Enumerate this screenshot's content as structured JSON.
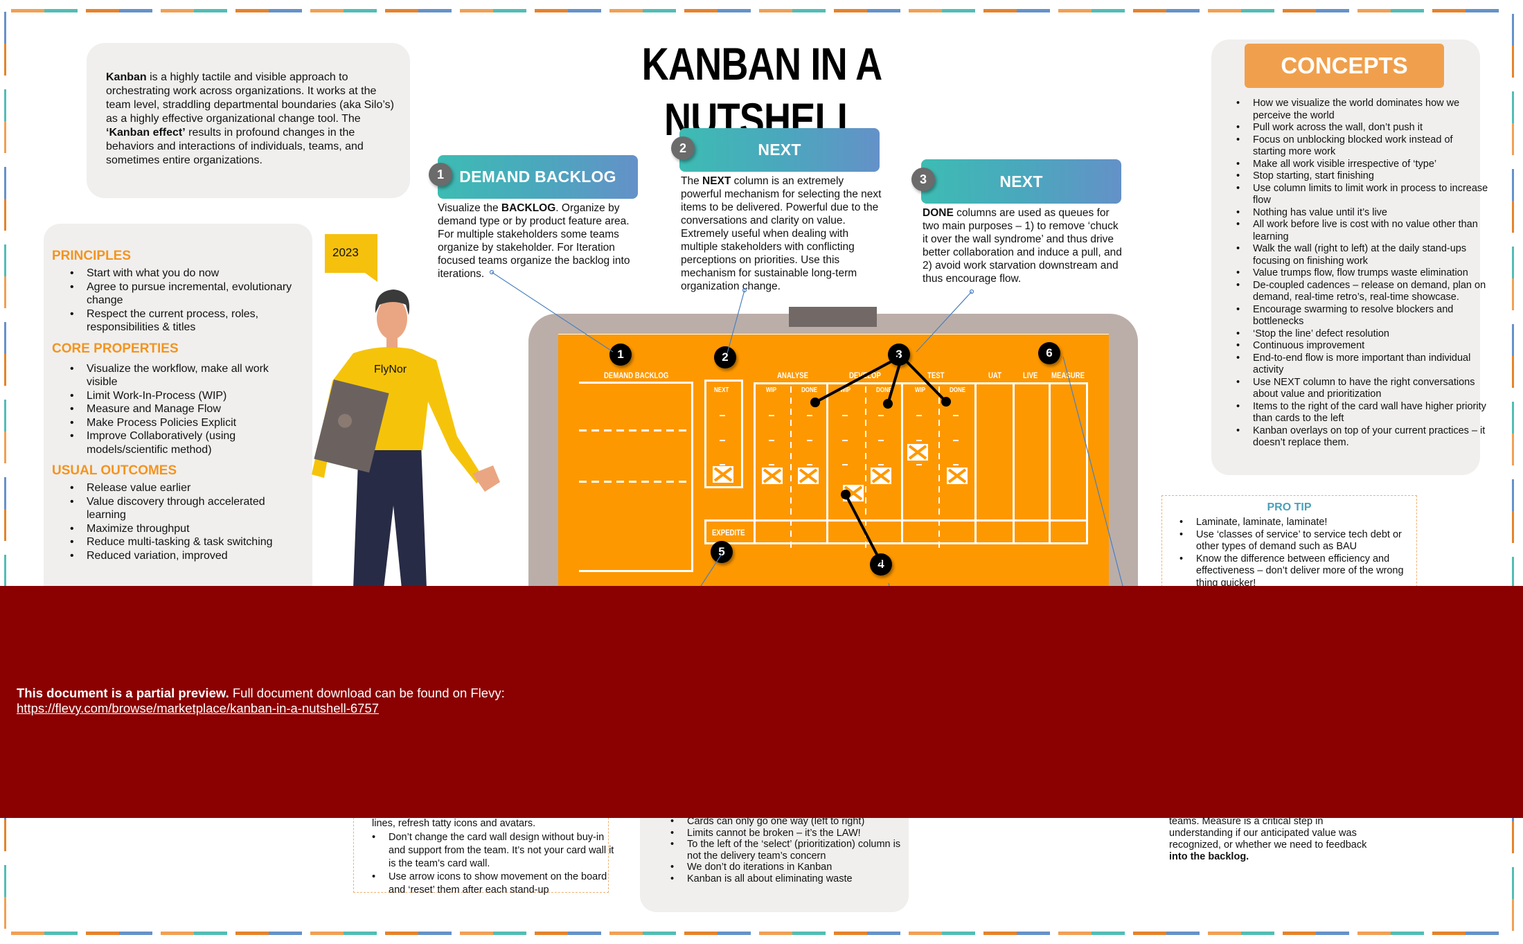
{
  "title": "KANBAN IN A NUTSHELL",
  "intro": {
    "bold_lead": "Kanban",
    "text_1": " is a highly tactile and visible approach to orchestrating work across  organizations. It works at the team level, straddling departmental boundaries (aka Silo’s) as a highly effective organizational change tool. The ",
    "bold_mid": "‘Kanban effect’",
    "text_2": " results in  profound changes in the behaviors and interactions of individuals, teams, and sometimes entire organizations."
  },
  "left_panel": {
    "principles_title": "PRINCIPLES",
    "principles": [
      "Start with what you do now",
      "Agree to pursue incremental, evolutionary change",
      "Respect the current process, roles, responsibilities & titles"
    ],
    "core_title": "CORE PROPERTIES",
    "core": [
      "Visualize the workflow, make all work visible",
      "Limit Work-In-Process (WIP)",
      "Measure and Manage Flow",
      "Make Process Policies Explicit",
      "Improve Collaboratively (using models/scientific method)"
    ],
    "outcomes_title": "USUAL OUTCOMES",
    "outcomes": [
      "Release value earlier",
      "Value discovery through accelerated learning",
      "Maximize throughput",
      "Reduce multi-tasking & task switching",
      "Reduced variation, improved"
    ]
  },
  "speech_tag": "2023",
  "shirt_text": "FlyNor",
  "steps": [
    {
      "num": "1",
      "title": "DEMAND BACKLOG",
      "pre": "Visualize the ",
      "bold": "BACKLOG",
      "post": ". Organize by demand  type or by product feature area. For multiple  stakeholders some teams organize by  stakeholder. For Iteration focused teams  organize the backlog into iterations."
    },
    {
      "num": "2",
      "title": "NEXT",
      "pre": "The ",
      "bold": "NEXT",
      "post": " column is an extremely powerful  mechanism for selecting the next items to be  delivered. Powerful due to the conversations  and clarity on value. Extremely useful when  dealing with multiple stakeholders with  conflicting perceptions on priorities. Use this mechanism for sustainable long-term organization change."
    },
    {
      "num": "3",
      "title": "NEXT",
      "pre": "",
      "bold": "DONE",
      "post": " columns are used as queues for two main purposes – 1) to remove ‘chuck it over the  wall syndrome’ and thus drive better  collaboration and induce a pull, and 2) avoid  work starvation downstream and thus  encourage flow."
    }
  ],
  "board": {
    "labels": {
      "backlog": "DEMAND BACKLOG",
      "next": "NEXT",
      "analyse": "ANALYSE",
      "develop": "DEVELOP",
      "test": "TEST",
      "uat": "UAT",
      "live": "LIVE",
      "measure": "MEASURE",
      "wip": "WIP",
      "done": "DONE",
      "expedite": "EXPEDITE"
    },
    "markers": [
      "1",
      "2",
      "3",
      "4",
      "5",
      "6"
    ]
  },
  "concepts": {
    "title": "CONCEPTS",
    "items": [
      "How we visualize the world dominates how we perceive the world",
      "Pull work across the wall, don’t push it",
      "Focus on unblocking blocked work instead of starting more work",
      "Make all work visible irrespective of ‘type’",
      "Stop starting, start finishing",
      "Use column limits to limit work in process to  increase flow",
      "Nothing has value until it’s live",
      "All work before live is cost with no value other than learning",
      "Walk the wall (right to left) at the daily stand-ups focusing on finishing work",
      "Value trumps flow, flow trumps waste elimination",
      "De-coupled cadences – release on demand, plan on demand, real-time retro’s, real-time showcase.",
      "Encourage swarming to resolve blockers and bottlenecks",
      "‘Stop the line’ defect resolution",
      "Continuous improvement",
      "End-to-end flow is more important than individual activity",
      "Use NEXT column to have the right conversations  about value and prioritization",
      "Items to the right of the card wall have higher priority than cards to the left",
      "Kanban overlays on top of your current practices – it doesn’t replace them."
    ]
  },
  "pro_tip": {
    "title": "PRO  TIP",
    "items": [
      "Laminate, laminate, laminate!",
      "Use ‘classes of service’ to service tech debt or other types of demand such as BAU",
      "Know the difference between efficiency and effectiveness – don’t deliver more of the wrong thing quicker!"
    ]
  },
  "bottom_left_tips": {
    "partial_line": "lines, refresh tatty icons and avatars.",
    "items": [
      "Don’t change the card wall design without  buy-in and support from the team. It’s not your card wall it is the team’s card wall.",
      "Use arrow icons to show movement on the board and ‘reset’ them after each stand-up"
    ]
  },
  "bottom_rules": {
    "items": [
      "Cards can only go one way (left to right)",
      "Limits cannot be broken – it’s the LAW!",
      "To the left of the ‘select’ (prioritization) column is not the delivery team’s concern",
      "We don’t do iterations in Kanban",
      "Kanban is all about eliminating waste"
    ]
  },
  "measure_note": {
    "text": "teams. Measure is a critical step in understanding if our anticipated value was  recognized, or whether we need to feedback ",
    "bold": "into the backlog."
  },
  "banner": {
    "bold": "This document is a partial preview.",
    "text": "  Full document download can be found on Flevy:",
    "link": "https://flevy.com/browse/marketplace/kanban-in-a-nutshell-6757"
  },
  "colors": {
    "accent_orange": "#f3941f",
    "board_orange": "#fe9800",
    "concepts_header": "#f0a04d",
    "teal": "#3dbcb3",
    "blue": "#6491c8",
    "banner_red": "#8b0000",
    "tag_yellow": "#f5c10d"
  }
}
